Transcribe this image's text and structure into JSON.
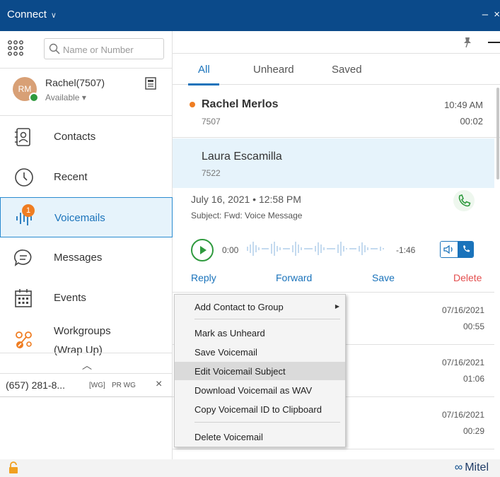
{
  "app": {
    "title": "Connect",
    "window_minimize": "–",
    "window_close": "×"
  },
  "search": {
    "placeholder": "Name or Number"
  },
  "profile": {
    "initials": "RM",
    "name": "Rachel(7507)",
    "status": "Available ▾"
  },
  "nav": {
    "contacts": "Contacts",
    "recent": "Recent",
    "voicemails": "Voicemails",
    "voicemails_badge": "1",
    "messages": "Messages",
    "events": "Events",
    "workgroups_line1": "Workgroups",
    "workgroups_line2": "(Wrap Up)"
  },
  "active_call": {
    "number": "(657) 281-8...",
    "tag1": "[WG]",
    "tag2": "PR WG",
    "close": "×"
  },
  "collapse_glyph": "︿",
  "tabs": [
    "All",
    "Unheard",
    "Saved"
  ],
  "voicemails": [
    {
      "name": "Rachel Merlos",
      "ext": "7507",
      "time": "10:49 AM",
      "duration": "00:02",
      "unheard": true
    },
    {
      "name": "Laura Escamilla",
      "ext": "7522",
      "selected": true
    }
  ],
  "detail": {
    "date": "July 16, 2021 • 12:58 PM",
    "subject": "Subject: Fwd: Voice Message",
    "current": "0:00",
    "remaining": "-1:46",
    "actions": {
      "reply": "Reply",
      "forward": "Forward",
      "save": "Save",
      "delete": "Delete"
    }
  },
  "list_rows": [
    {
      "date": "07/16/2021",
      "duration": "00:55"
    },
    {
      "date": "07/16/2021",
      "duration": "01:06"
    },
    {
      "date": "07/16/2021",
      "duration": "00:29"
    }
  ],
  "context_menu": {
    "add_contact": "Add Contact to Group",
    "mark_unheard": "Mark as Unheard",
    "save_voicemail": "Save Voicemail",
    "edit_subject": "Edit Voicemail Subject",
    "download_wav": "Download Voicemail as WAV",
    "copy_id": "Copy Voicemail ID to Clipboard",
    "delete_voicemail": "Delete Voicemail"
  },
  "brand": {
    "logo": "∞",
    "name": "Mitel"
  },
  "colors": {
    "titlebar": "#0b4a8a",
    "accent": "#1a73bb",
    "unheard_dot": "#ef7d22",
    "delete": "#e34e4e",
    "play": "#2f9a3e"
  }
}
